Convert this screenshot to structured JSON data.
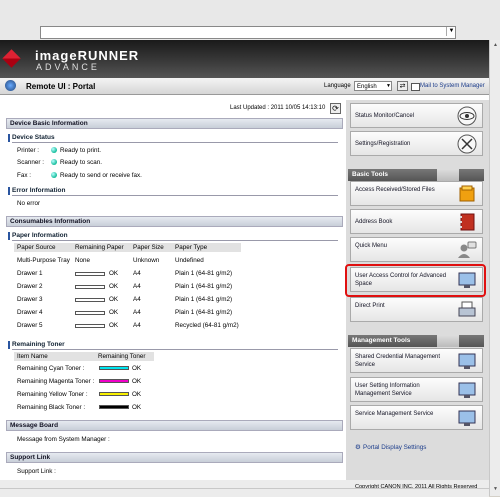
{
  "header": {
    "brand_line1": "imageRUNNER",
    "brand_line2": "ADVANCE",
    "title": "Remote UI : Portal",
    "language_label": "Language",
    "language_value": "English",
    "mail_link": "Mail to System Manager"
  },
  "main": {
    "last_updated": "Last Updated : 2011 10/05 14:13:10",
    "device_basic_info": "Device Basic Information",
    "device_status": {
      "heading": "Device Status",
      "rows": [
        {
          "label": "Printer :",
          "status": "Ready to print."
        },
        {
          "label": "Scanner :",
          "status": "Ready to scan."
        },
        {
          "label": "Fax :",
          "status": "Ready to send or receive fax."
        }
      ]
    },
    "error_info": {
      "heading": "Error Information",
      "text": "No error"
    },
    "consumables_info": "Consumables Information",
    "paper_info": {
      "heading": "Paper Information",
      "columns": [
        "Paper Source",
        "Remaining Paper",
        "Paper Size",
        "Paper Type"
      ],
      "rows": [
        {
          "source": "Multi-Purpose Tray",
          "remaining": "None",
          "size": "Unknown",
          "type": "Undefined"
        },
        {
          "source": "Drawer 1",
          "remaining": "OK",
          "size": "A4",
          "type": "Plain 1 (64-81 g/m2)"
        },
        {
          "source": "Drawer 2",
          "remaining": "OK",
          "size": "A4",
          "type": "Plain 1 (64-81 g/m2)"
        },
        {
          "source": "Drawer 3",
          "remaining": "OK",
          "size": "A4",
          "type": "Plain 1 (64-81 g/m2)"
        },
        {
          "source": "Drawer 4",
          "remaining": "OK",
          "size": "A4",
          "type": "Plain 1 (64-81 g/m2)"
        },
        {
          "source": "Drawer 5",
          "remaining": "OK",
          "size": "A4",
          "type": "Recycled (64-81 g/m2)"
        }
      ]
    },
    "toner": {
      "heading": "Remaining Toner",
      "columns": [
        "Item Name",
        "Remaining Toner"
      ],
      "rows": [
        {
          "name": "Remaining Cyan Toner :",
          "status": "OK",
          "color": "#00e5f0"
        },
        {
          "name": "Remaining Magenta Toner :",
          "status": "OK",
          "color": "#f000c8"
        },
        {
          "name": "Remaining Yellow Toner :",
          "status": "OK",
          "color": "#f8f000"
        },
        {
          "name": "Remaining Black Toner :",
          "status": "OK",
          "color": "#000000"
        }
      ]
    },
    "message_board": {
      "heading": "Message Board",
      "text": "Message from System Manager :"
    },
    "support_link": {
      "heading": "Support Link",
      "text": "Support Link :"
    }
  },
  "right": {
    "status_monitor": "Status Monitor/Cancel",
    "settings": "Settings/Registration",
    "basic_tools": {
      "heading": "Basic Tools",
      "items": [
        "Access Received/Stored Files",
        "Address Book",
        "Quick Menu",
        "User Access Control for Advanced Space",
        "Direct Print"
      ]
    },
    "management_tools": {
      "heading": "Management Tools",
      "items": [
        "Shared Credential Management Service",
        "User Setting Information Management Service",
        "Service Management Service"
      ]
    },
    "portal_settings": "Portal Display Settings"
  },
  "footer": {
    "copyright": "Copyright CANON INC. 2011 All Rights Reserved"
  }
}
